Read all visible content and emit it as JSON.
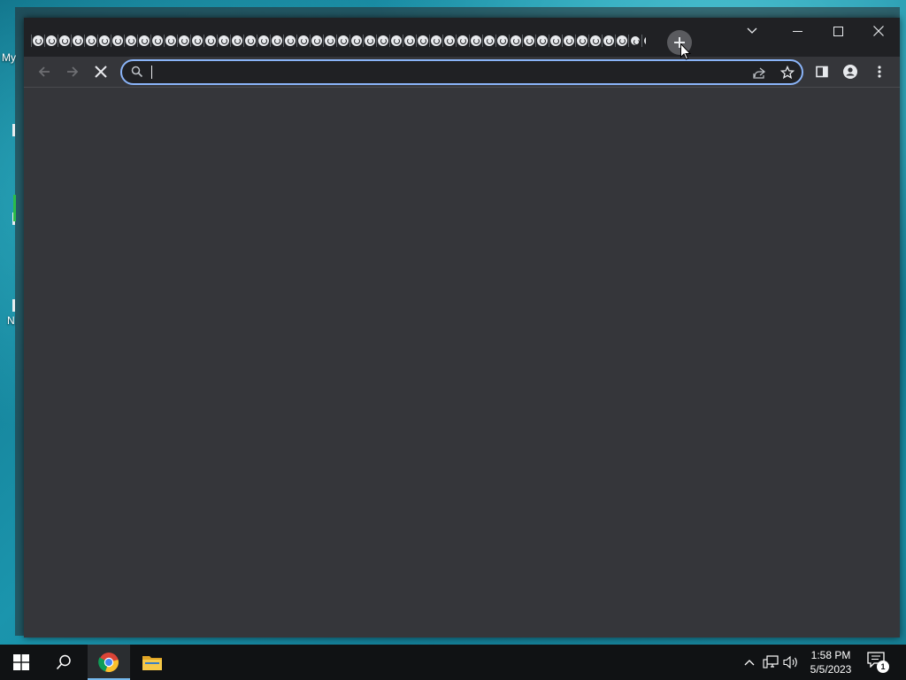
{
  "desktop": {
    "icon_labels": [
      "My",
      "N"
    ]
  },
  "browser": {
    "name": "Google Chrome",
    "tab_count_visible": 48,
    "new_tab_label": "+",
    "omnibox": {
      "value": "",
      "placeholder": ""
    },
    "page_state": "loading",
    "colors": {
      "frame": "#202124",
      "toolbar": "#35363a",
      "omnibox_focus": "#8ab4f8"
    }
  },
  "taskbar": {
    "apps": [
      {
        "name": "Start",
        "icon": "windows-logo-icon"
      },
      {
        "name": "Search",
        "icon": "search-icon"
      },
      {
        "name": "Google Chrome",
        "icon": "chrome-icon",
        "active": true
      },
      {
        "name": "File Explorer",
        "icon": "folder-icon"
      }
    ],
    "clock": {
      "time": "1:58 PM",
      "date": "5/5/2023"
    },
    "notifications": {
      "count": "1"
    }
  }
}
